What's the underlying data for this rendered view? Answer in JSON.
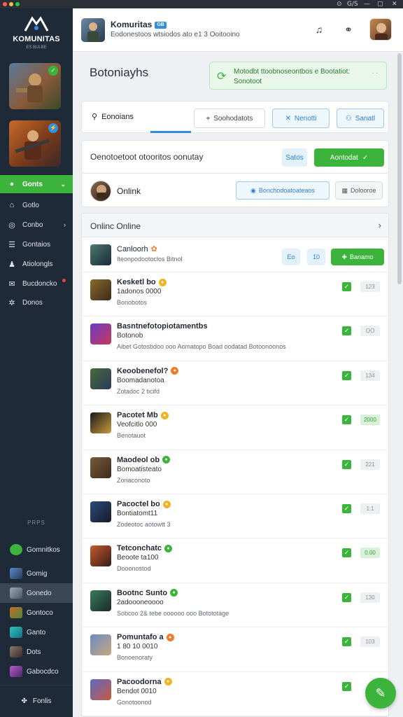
{
  "titlebar": {
    "buttons": [
      "⊙",
      "G/S",
      "—",
      "▢",
      "✕"
    ]
  },
  "sidebar": {
    "logo_text": "KOMUNITAS",
    "logo_sub": "ES BULBE",
    "nav": [
      {
        "label": "Gonts",
        "icon": "gamepad-icon",
        "active": true
      },
      {
        "label": "Gotlo",
        "icon": "home-icon"
      },
      {
        "label": "Conbo",
        "icon": "globe-icon"
      },
      {
        "label": "Gontaios",
        "icon": "list-icon"
      },
      {
        "label": "Atiolongls",
        "icon": "people-icon"
      },
      {
        "label": "Bucdoncko",
        "icon": "chat-icon"
      },
      {
        "label": "Donos",
        "icon": "settings-icon"
      }
    ],
    "section_label": "PRPS",
    "communities": [
      {
        "label": "Gomnitkos"
      },
      {
        "label": "Gomig"
      },
      {
        "label": "Gonedo"
      },
      {
        "label": "Gontoco"
      },
      {
        "label": "Ganto"
      },
      {
        "label": "Dots"
      },
      {
        "label": "Gabocdco"
      }
    ],
    "footer_label": "Fonlis"
  },
  "header": {
    "title": "Komuritas",
    "badge": "GB",
    "subtitle": "Eodonestoos wtsiodos ato  e1 3  Ooitooino"
  },
  "main": {
    "page_title": "Botoniayhs",
    "notice": {
      "line1": "Motodbt ttoobnoseontbos  e Bootatiot:",
      "line2": "Sonotoot",
      "dismiss": "∙ ∙"
    },
    "tabs": {
      "members": "Eonoians",
      "search": "Soohodatots",
      "newest": "Nenotti",
      "sort": "Sanatl"
    },
    "filter": {
      "label": "Oenotoetoot otooritos oonutay",
      "btn_light": "Satos",
      "btn_green": "Aontodat"
    },
    "online": {
      "label": "Onlink",
      "btn_blue": "Bonchodoatoateaos",
      "btn_grey": "Dolooroe"
    },
    "list_header": "Onlinc  Online",
    "first_row": {
      "name": "Canloorh",
      "sub": "Iteonpodootoclos Bitnol",
      "btn1": "Eo",
      "btn2": "10",
      "btn3": "Banamo"
    },
    "rows": [
      {
        "name": "Kesketl bo",
        "line": "1adonos 0000",
        "sub": "Bonobotos",
        "coin": "gold",
        "score": "123",
        "hi": false
      },
      {
        "name": "Basntnefotopiotamentbs",
        "line": "Botonob",
        "sub": "Aibet Gotosbdoo ooo Aomatopo Boad oodatad Botoonoonos",
        "coin": "",
        "score": "OO",
        "hi": false
      },
      {
        "name": "Keoobenefol?",
        "line": "Boomadanotoa",
        "sub": "Zotadoc 2 ticifd",
        "coin": "orange",
        "score": "134",
        "hi": false
      },
      {
        "name": "Pacotet Mb",
        "line": "Veofcitlo 000",
        "sub": "Benotauot",
        "coin": "gold",
        "score": "2000",
        "hi": true
      },
      {
        "name": "Maodeol ob",
        "line": "Bomoatisteato",
        "sub": "Zoriaconoto",
        "coin": "green",
        "score": "221",
        "hi": false
      },
      {
        "name": "Pacoctel bo",
        "line": "Bontiatomt11",
        "sub": "Zodeotoc aotowtt 3",
        "coin": "gold",
        "score": "1:1",
        "hi": false
      },
      {
        "name": "Tetconchatc",
        "line": "Beoote ta100",
        "sub": "Dooonostod",
        "coin": "green",
        "score": "0.00",
        "hi": true
      },
      {
        "name": "Bootnc Sunto",
        "line": "2adoooneoooo",
        "sub": "Sobcoo 2& tebe  oooooo ooo  Botototage",
        "coin": "green",
        "score": "130",
        "hi": false
      },
      {
        "name": "Pomuntafo a",
        "line": "1 80 10 0010",
        "sub": "Bonoenoraty",
        "coin": "orange",
        "score": "103",
        "hi": false
      },
      {
        "name": "Pacoodorna",
        "line": "Bendot 0010",
        "sub": "Gonotoonod",
        "coin": "gold",
        "score": "",
        "hi": false
      }
    ]
  },
  "colors": {
    "sidebar_bg": "#1f2a38",
    "accent_green": "#3cb43c",
    "accent_blue": "#2f8fde"
  },
  "icons": {
    "fab": "edit-icon"
  }
}
